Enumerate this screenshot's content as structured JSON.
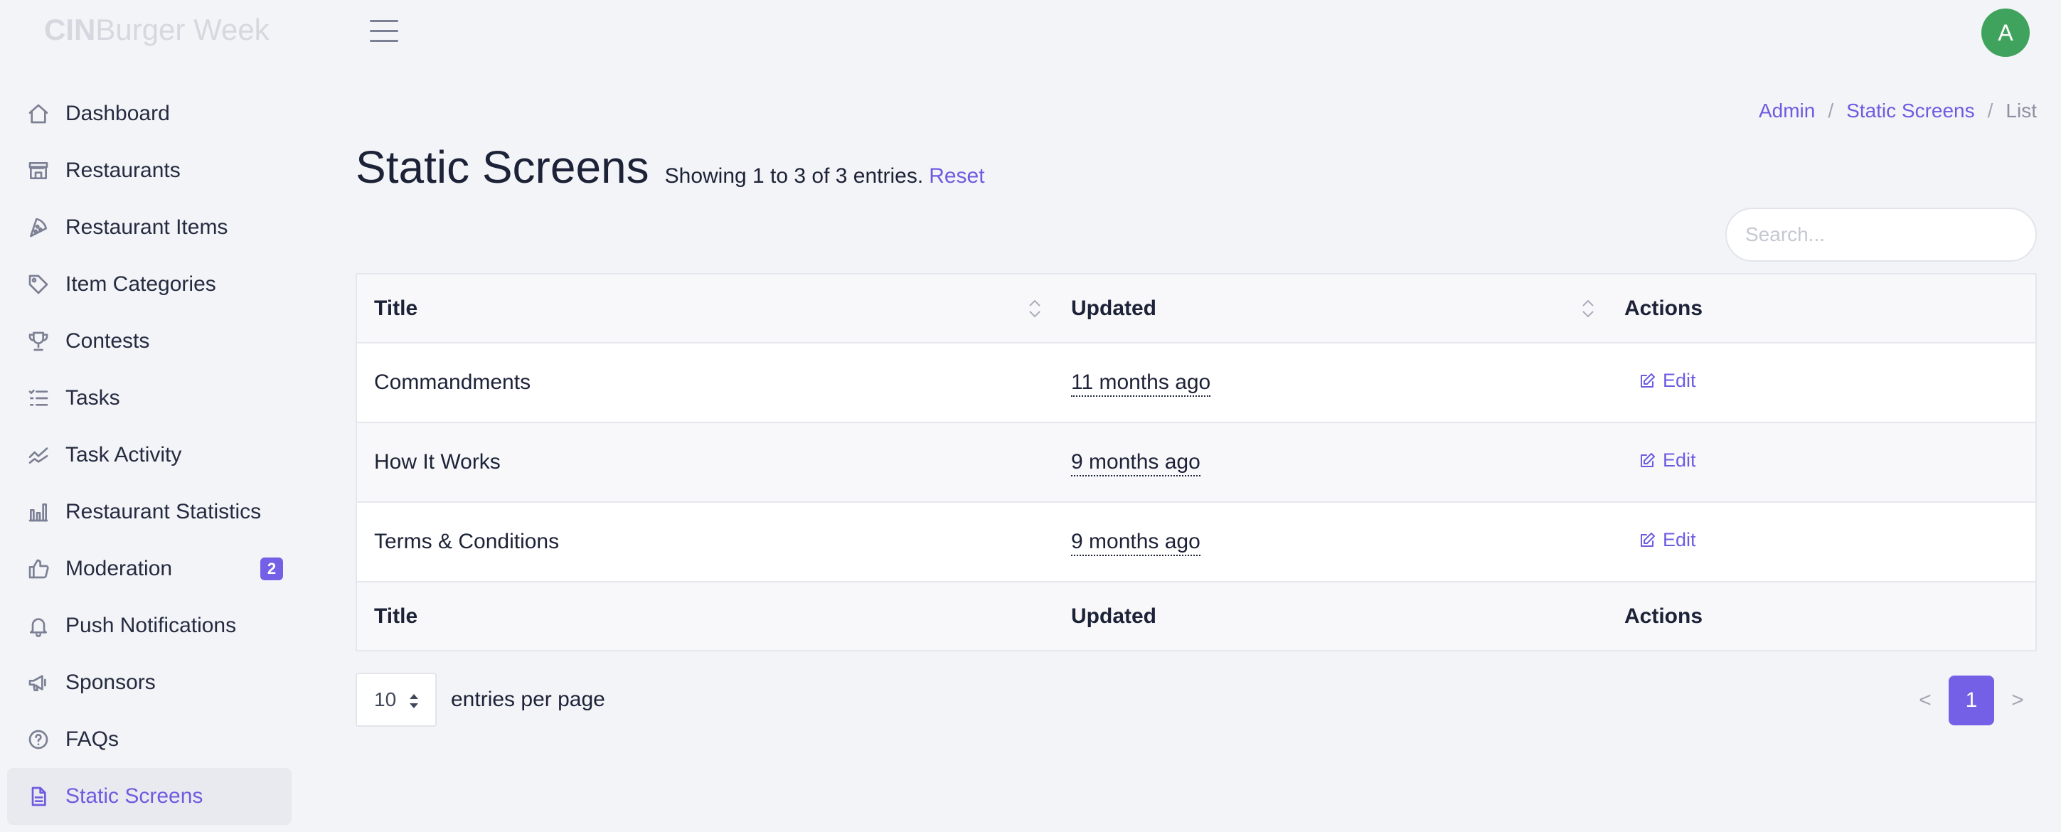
{
  "brand": {
    "bold": "CIN",
    "rest": "Burger Week"
  },
  "sidebar": {
    "items": [
      {
        "label": "Dashboard",
        "icon": "home-icon"
      },
      {
        "label": "Restaurants",
        "icon": "store-icon"
      },
      {
        "label": "Restaurant Items",
        "icon": "pizza-icon"
      },
      {
        "label": "Item Categories",
        "icon": "tag-icon"
      },
      {
        "label": "Contests",
        "icon": "trophy-icon"
      },
      {
        "label": "Tasks",
        "icon": "list-check-icon"
      },
      {
        "label": "Task Activity",
        "icon": "activity-chart-icon"
      },
      {
        "label": "Restaurant Statistics",
        "icon": "bar-chart-icon"
      },
      {
        "label": "Moderation",
        "icon": "thumbs-up-icon",
        "badge": "2"
      },
      {
        "label": "Push Notifications",
        "icon": "bell-icon"
      },
      {
        "label": "Sponsors",
        "icon": "megaphone-icon"
      },
      {
        "label": "FAQs",
        "icon": "question-circle-icon"
      },
      {
        "label": "Static Screens",
        "icon": "document-icon",
        "active": true
      }
    ]
  },
  "header": {
    "avatar_letter": "A"
  },
  "breadcrumb": {
    "admin": "Admin",
    "section": "Static Screens",
    "current": "List",
    "separator": "/"
  },
  "page": {
    "title": "Static Screens",
    "showing": "Showing 1 to 3 of 3 entries.",
    "reset": "Reset"
  },
  "search": {
    "placeholder": "Search..."
  },
  "table": {
    "columns": {
      "title": "Title",
      "updated": "Updated",
      "actions": "Actions"
    },
    "rows": [
      {
        "title": "Commandments",
        "updated": "11 months ago",
        "action": "Edit"
      },
      {
        "title": "How It Works",
        "updated": "9 months ago",
        "action": "Edit"
      },
      {
        "title": "Terms & Conditions",
        "updated": "9 months ago",
        "action": "Edit"
      }
    ]
  },
  "per_page": {
    "value": "10",
    "label": "entries per page"
  },
  "pagination": {
    "prev": "<",
    "current": "1",
    "next": ">"
  },
  "colors": {
    "accent": "#6c5ce0",
    "badge": "#7360e6",
    "avatar": "#3fa35d"
  }
}
